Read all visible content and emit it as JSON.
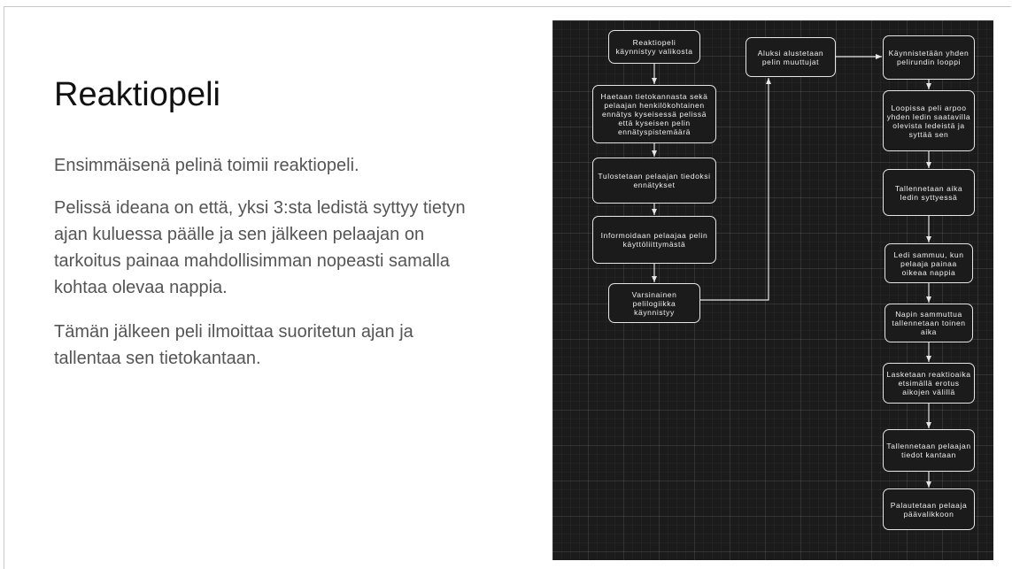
{
  "slide": {
    "title": "Reaktiopeli",
    "paragraphs": [
      "Ensimmäisenä pelinä toimii reaktiopeli.",
      "Pelissä ideana on että, yksi 3:sta ledistä syttyy tietyn ajan kuluessa päälle ja sen jälkeen pelaajan on tarkoitus painaa mahdollisimman nopeasti samalla kohtaa olevaa nappia.",
      "Tämän jälkeen peli ilmoittaa suoritetun ajan ja tallentaa sen tietokantaan."
    ]
  },
  "flowchart": {
    "nodes": {
      "n1": "Reaktiopeli käynnistyy valikosta",
      "n2": "Haetaan tietokannasta sekä pelaajan henkilökohtainen ennätys kyseisessä pelissä että kyseisen pelin ennätyspistemäärä",
      "n3": "Tulostetaan pelaajan tiedoksi ennätykset",
      "n4": "Informoidaan pelaajaa pelin käyttöliittymästä",
      "n5": "Varsinainen pelilogiikka käynnistyy",
      "n6": "Aluksi alustetaan pelin muuttujat",
      "n7": "Käynnistetään yhden pelirundin looppi",
      "n8": "Loopissa peli arpoo yhden ledin saatavilla olevista ledeistä ja syttää sen",
      "n9": "Tallennetaan aika ledin syttyessä",
      "n10": "Ledi sammuu, kun pelaaja painaa oikeaa nappia",
      "n11": "Napin sammuttua tallennetaan toinen aika",
      "n12": "Lasketaan reaktioaika etsimällä erotus aikojen välillä",
      "n13": "Tallennetaan pelaajan tiedot kantaan",
      "n14": "Palautetaan pelaaja päävalikkoon"
    }
  }
}
